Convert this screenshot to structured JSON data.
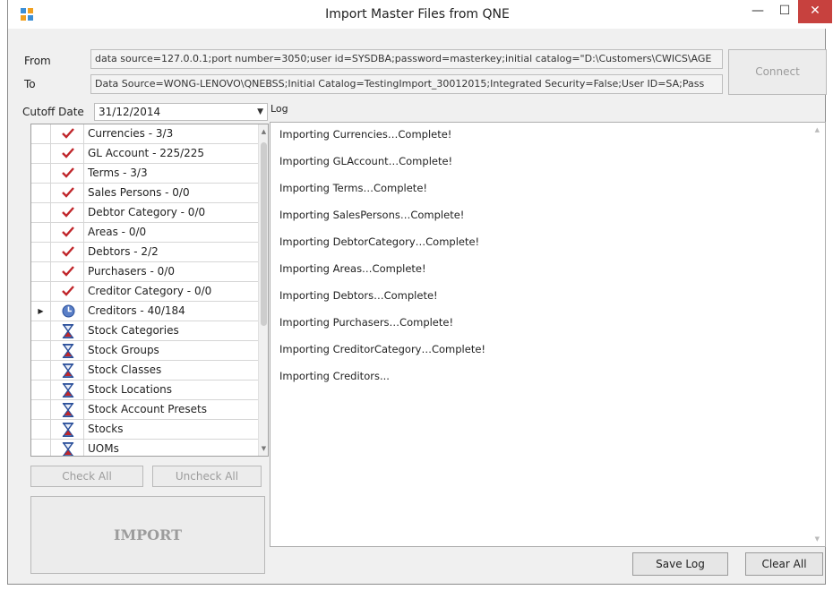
{
  "window": {
    "title": "Import Master Files from QNE",
    "controls": {
      "minimize": "—",
      "maximize": "☐",
      "close": "✕"
    }
  },
  "connection": {
    "from_label": "From",
    "from_value": "data source=127.0.0.1;port number=3050;user id=SYSDBA;password=masterkey;initial catalog=\"D:\\Customers\\CWICS\\AGE",
    "to_label": "To",
    "to_value": "Data Source=WONG-LENOVO\\QNEBSS;Initial Catalog=TestingImport_30012015;Integrated Security=False;User ID=SA;Pass",
    "connect_label": "Connect"
  },
  "cutoff": {
    "label": "Cutoff Date",
    "value": "31/12/2014",
    "arrow": "▼"
  },
  "log_label": "Log",
  "items": [
    {
      "label": "Currencies - 3/3",
      "status": "check"
    },
    {
      "label": "GL Account - 225/225",
      "status": "check"
    },
    {
      "label": "Terms - 3/3",
      "status": "check"
    },
    {
      "label": "Sales Persons - 0/0",
      "status": "check"
    },
    {
      "label": "Debtor Category - 0/0",
      "status": "check"
    },
    {
      "label": "Areas - 0/0",
      "status": "check"
    },
    {
      "label": "Debtors - 2/2",
      "status": "check"
    },
    {
      "label": "Purchasers - 0/0",
      "status": "check"
    },
    {
      "label": "Creditor Category - 0/0",
      "status": "check"
    },
    {
      "label": "Creditors - 40/184",
      "status": "progress",
      "current": true
    },
    {
      "label": "Stock Categories",
      "status": "pending"
    },
    {
      "label": "Stock Groups",
      "status": "pending"
    },
    {
      "label": "Stock Classes",
      "status": "pending"
    },
    {
      "label": "Stock Locations",
      "status": "pending"
    },
    {
      "label": "Stock Account Presets",
      "status": "pending"
    },
    {
      "label": "Stocks",
      "status": "pending"
    },
    {
      "label": "UOMs",
      "status": "pending"
    }
  ],
  "buttons": {
    "check_all": "Check All",
    "uncheck_all": "Uncheck All",
    "import": "IMPORT",
    "save_log": "Save Log",
    "clear_all": "Clear All"
  },
  "log_lines": [
    "Importing Currencies…Complete!",
    "Importing GLAccount…Complete!",
    "Importing Terms…Complete!",
    "Importing SalesPersons…Complete!",
    "Importing DebtorCategory…Complete!",
    "Importing Areas…Complete!",
    "Importing Debtors…Complete!",
    "Importing Purchasers…Complete!",
    "Importing CreditorCategory…Complete!",
    "Importing Creditors..."
  ],
  "colors": {
    "check": "#c0262b",
    "close_button": "#c7413e",
    "hourglass_blue": "#2a4f9a",
    "hourglass_red": "#c0262b"
  }
}
